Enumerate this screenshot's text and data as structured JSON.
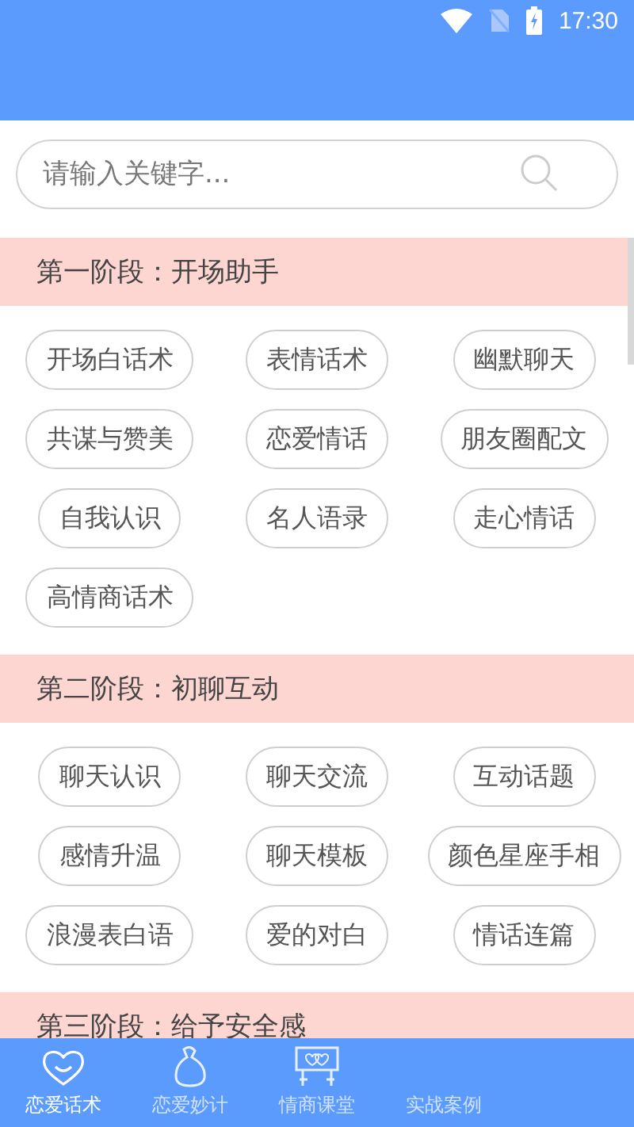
{
  "status_bar": {
    "time": "17:30"
  },
  "search": {
    "placeholder": "请输入关键字..."
  },
  "sections": [
    {
      "title": "第一阶段：开场助手",
      "tags": [
        "开场白话术",
        "表情话术",
        "幽默聊天",
        "共谋与赞美",
        "恋爱情话",
        "朋友圈配文",
        "自我认识",
        "名人语录",
        "走心情话",
        "高情商话术"
      ]
    },
    {
      "title": "第二阶段：初聊互动",
      "tags": [
        "聊天认识",
        "聊天交流",
        "互动话题",
        "感情升温",
        "聊天模板",
        "颜色星座手相",
        "浪漫表白语",
        "爱的对白",
        "情话连篇"
      ]
    },
    {
      "title": "第三阶段：给予安全感"
    }
  ],
  "bottom_nav": [
    {
      "label": "恋爱话术",
      "selected": true
    },
    {
      "label": "恋爱妙计",
      "selected": false
    },
    {
      "label": "情商课堂",
      "selected": false
    },
    {
      "label": "实战案例",
      "selected": false
    }
  ]
}
